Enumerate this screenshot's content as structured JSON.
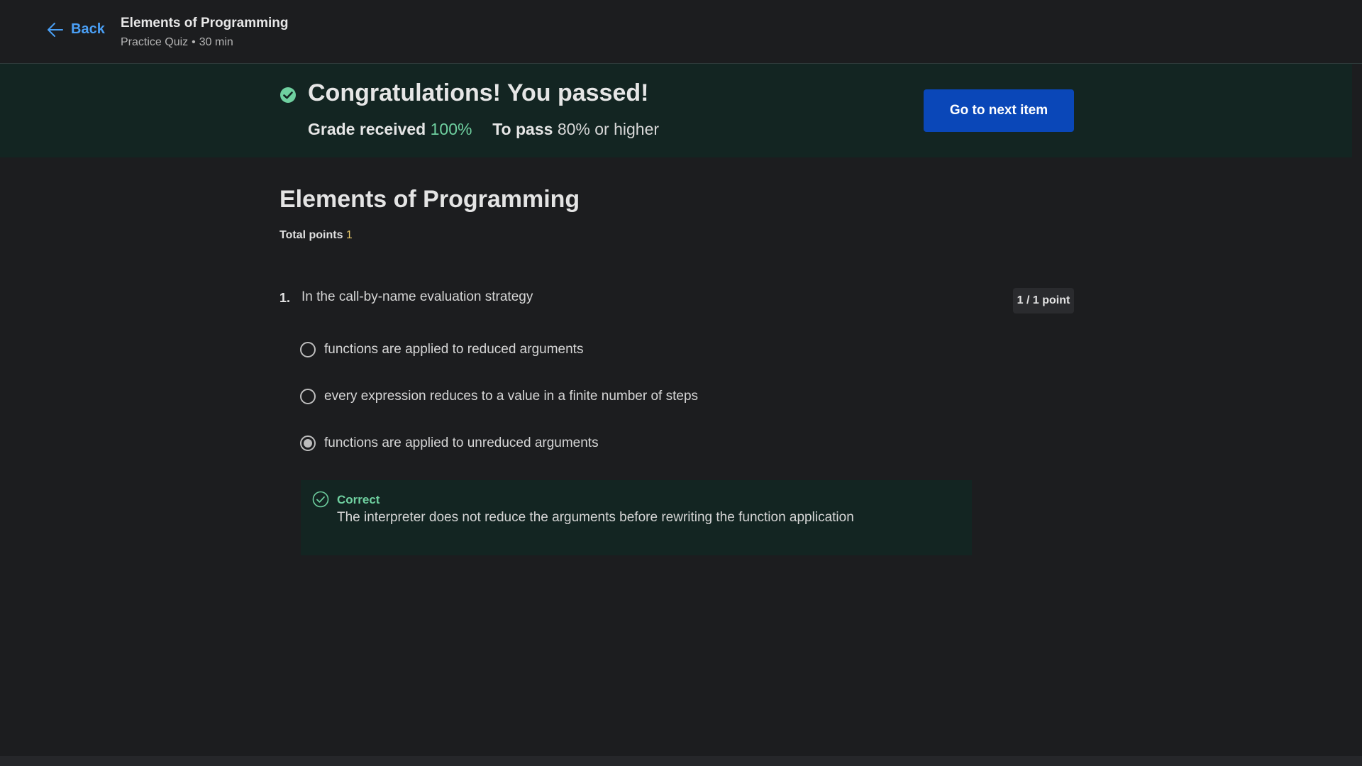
{
  "header": {
    "back_label": "Back",
    "course_title": "Elements of Programming",
    "subtitle_type": "Practice Quiz",
    "subtitle_separator": "•",
    "subtitle_duration": "30 min"
  },
  "result_banner": {
    "title": "Congratulations! You passed!",
    "grade_label": "Grade received",
    "grade_value": "100%",
    "pass_label": "To pass",
    "pass_value": "80% or higher",
    "next_button": "Go to next item"
  },
  "quiz": {
    "title": "Elements of Programming",
    "total_points_label": "Total points",
    "total_points_value": "1",
    "questions": [
      {
        "number": "1.",
        "text": "In the call-by-name evaluation strategy",
        "points": "1 / 1 point",
        "options": [
          {
            "label": "functions are applied to reduced arguments",
            "selected": false
          },
          {
            "label": "every expression reduces to a value in a finite number of steps",
            "selected": false
          },
          {
            "label": "functions are applied to unreduced arguments",
            "selected": true
          }
        ],
        "feedback": {
          "status": "Correct",
          "explanation": "The interpreter does not reduce the arguments before rewriting the function application"
        }
      }
    ]
  },
  "colors": {
    "background": "#1c1d1f",
    "banner_bg": "#132522",
    "accent_green": "#6fd0a0",
    "link_blue": "#4a9ff5",
    "primary_button": "#0a47b8"
  },
  "icons": {
    "back": "arrow-left-icon",
    "passed": "check-circle-filled-icon",
    "correct": "check-circle-outline-icon"
  }
}
